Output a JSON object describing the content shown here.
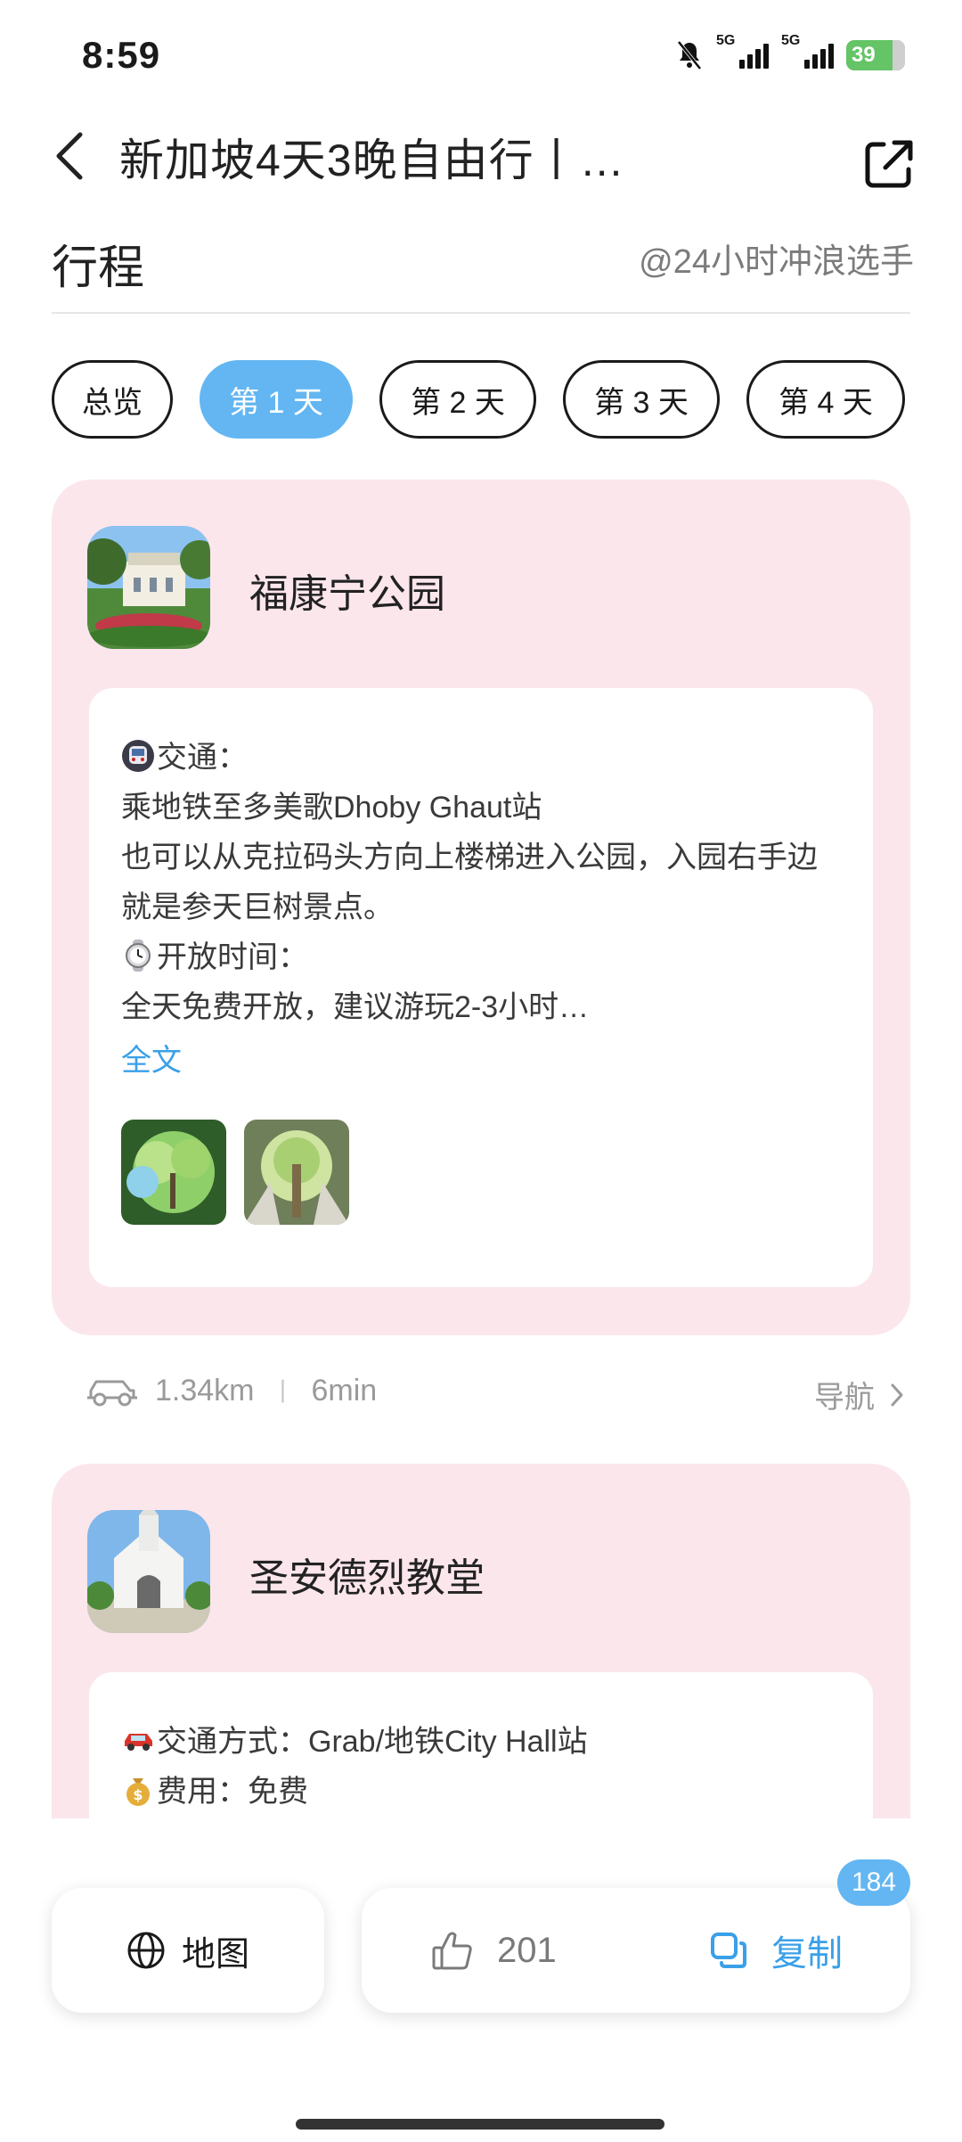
{
  "status": {
    "time": "8:59",
    "network1": "5G",
    "network2": "5G",
    "battery": "39"
  },
  "header": {
    "title": "新加坡4天3晚自由行丨…"
  },
  "section": {
    "title": "行程",
    "author": "@24小时冲浪选手"
  },
  "tabs": [
    {
      "label": "总览"
    },
    {
      "label": "第 1 天"
    },
    {
      "label": "第 2 天"
    },
    {
      "label": "第 3 天"
    },
    {
      "label": "第 4 天"
    }
  ],
  "active_tab_index": 1,
  "places": [
    {
      "name": "福康宁公园",
      "lines": [
        {
          "emoji": "metro-icon",
          "text": "交通："
        },
        {
          "emoji": "",
          "text": "乘地铁至多美歌Dhoby Ghaut站"
        },
        {
          "emoji": "",
          "text": "也可以从克拉码头方向上楼梯进入公园，入园右手边"
        },
        {
          "emoji": "",
          "text": "就是参天巨树景点。"
        },
        {
          "emoji": "watch-icon",
          "text": "开放时间："
        },
        {
          "emoji": "",
          "text": "全天免费开放，建议游玩2-3小时…"
        }
      ],
      "full_text_label": "全文"
    },
    {
      "name": "圣安德烈教堂",
      "lines": [
        {
          "emoji": "car-icon",
          "text": "交通方式：Grab/地铁City Hall站"
        },
        {
          "emoji": "money-bag-icon",
          "text": "费用：免费"
        }
      ]
    }
  ],
  "route": {
    "distance": "1.34km",
    "separator": "丨",
    "duration": "6min",
    "nav_label": "导航"
  },
  "bottom": {
    "map_label": "地图",
    "like_count": "201",
    "copy_label": "复制",
    "copy_badge": "184"
  },
  "colors": {
    "accent": "#63b6f2",
    "card_bg": "#fbe6ec",
    "link": "#3aa0e8"
  }
}
